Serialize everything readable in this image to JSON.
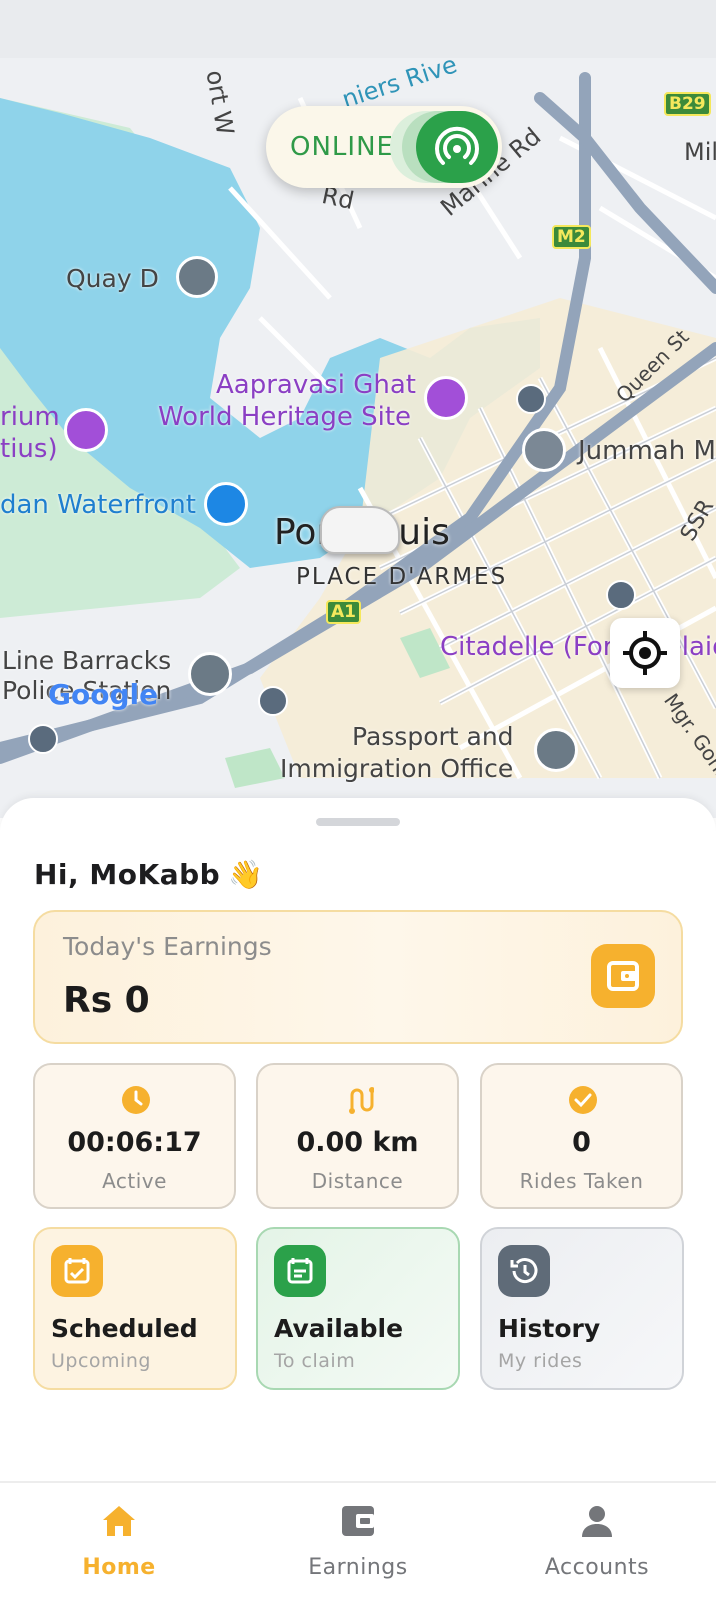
{
  "colors": {
    "accent": "#f6b12e",
    "online_green": "#2ba14a",
    "water": "#8fd3ea",
    "park": "#cdebd6",
    "road": "#93a4ba"
  },
  "online_toggle": {
    "label": "ONLINE",
    "icon": "broadcast-icon",
    "state": "on"
  },
  "map": {
    "labels": {
      "road_port": "ort W",
      "river": "niers Rive",
      "road_rd": "Rd",
      "marine": "Marine Rd",
      "b29": "B29",
      "mil": "Mil",
      "m2": "M2",
      "quay": "Quay D",
      "queen": "Queen St",
      "aapravasi_1": "Aapravasi Ghat",
      "aapravasi_2": "World Heritage Site",
      "rium": "rium",
      "tius": "tius)",
      "jummah": "Jummah M",
      "waterfront": "dan Waterfront",
      "port_louis": "Port Louis",
      "ssr": "SSR",
      "place": "PLACE D'ARMES",
      "a1": "A1",
      "citadelle": "Citadelle (Fort Adelaide)",
      "line_barracks": "Line Barracks",
      "police": "Police Station",
      "google": "Google",
      "passport_1": "Passport and",
      "passport_2": "Immigration Office",
      "mgr": "Mgr. Gonin"
    }
  },
  "sheet": {
    "greeting": "Hi, MoKabb",
    "greeting_emoji": "👋",
    "earnings": {
      "title": "Today's Earnings",
      "value": "Rs 0",
      "icon": "wallet-icon"
    },
    "stats": [
      {
        "value": "00:06:17",
        "label": "Active",
        "icon": "clock-icon"
      },
      {
        "value": "0.00 km",
        "label": "Distance",
        "icon": "route-icon"
      },
      {
        "value": "0",
        "label": "Rides Taken",
        "icon": "check-circle-icon"
      }
    ],
    "actions": [
      {
        "title": "Scheduled",
        "subtitle": "Upcoming",
        "icon": "calendar-check-icon"
      },
      {
        "title": "Available",
        "subtitle": "To claim",
        "icon": "calendar-list-icon"
      },
      {
        "title": "History",
        "subtitle": "My rides",
        "icon": "history-icon"
      }
    ]
  },
  "nav": [
    {
      "label": "Home",
      "icon": "home-icon",
      "active": true
    },
    {
      "label": "Earnings",
      "icon": "wallet-icon",
      "active": false
    },
    {
      "label": "Accounts",
      "icon": "person-icon",
      "active": false
    }
  ]
}
